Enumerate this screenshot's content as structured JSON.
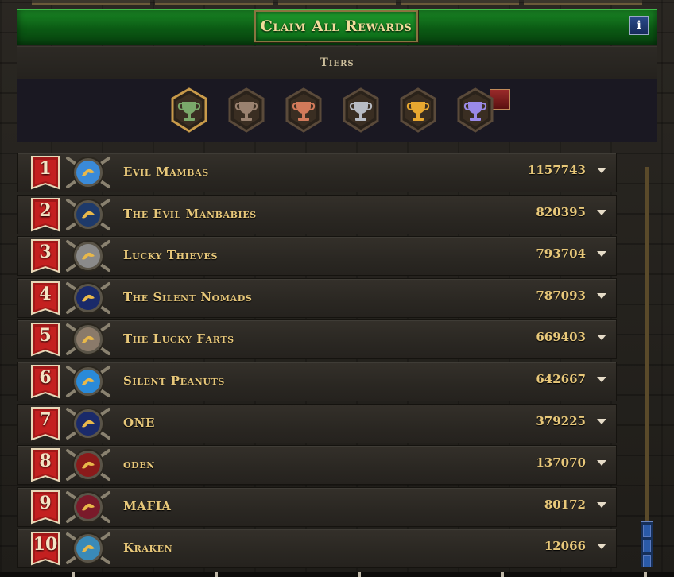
{
  "header": {
    "claim_label": "Claim All Rewards",
    "info_label": "i"
  },
  "tiers": {
    "title": "Tiers",
    "items": [
      {
        "name": "trophy-green-icon",
        "color": "#7aa86a",
        "selected": true
      },
      {
        "name": "trophy-bronze-dark-icon",
        "color": "#9a8270",
        "selected": false
      },
      {
        "name": "trophy-copper-icon",
        "color": "#d27a5a",
        "selected": false
      },
      {
        "name": "trophy-silver-icon",
        "color": "#b8bcc4",
        "selected": false
      },
      {
        "name": "trophy-gold-icon",
        "color": "#e8a830",
        "selected": false
      },
      {
        "name": "trophy-purple-icon",
        "color": "#9a8ae8",
        "selected": false
      }
    ]
  },
  "leaderboard": [
    {
      "rank": "1",
      "name": "Evil Mambas",
      "score": "1157743",
      "emblem": "serpent-emblem-icon",
      "emblem_color": "#3a8ad8"
    },
    {
      "rank": "2",
      "name": "The Evil Manbabies",
      "score": "820395",
      "emblem": "serpent-emblem-icon",
      "emblem_color": "#1e3a6a"
    },
    {
      "rank": "3",
      "name": "Lucky Thieves",
      "score": "793704",
      "emblem": "fleur-emblem-icon",
      "emblem_color": "#8a8a8a"
    },
    {
      "rank": "4",
      "name": "The Silent Nomads",
      "score": "787093",
      "emblem": "bird-emblem-icon",
      "emblem_color": "#1a2a6a"
    },
    {
      "rank": "5",
      "name": "The Lucky Farts",
      "score": "669403",
      "emblem": "ram-emblem-icon",
      "emblem_color": "#8a7a6a"
    },
    {
      "rank": "6",
      "name": "Silent Peanuts",
      "score": "642667",
      "emblem": "eagle-emblem-icon",
      "emblem_color": "#2a8ad8"
    },
    {
      "rank": "7",
      "name": "ONE",
      "score": "379225",
      "emblem": "bird-emblem-icon",
      "emblem_color": "#1a2a6a"
    },
    {
      "rank": "8",
      "name": "oden",
      "score": "137070",
      "emblem": "helmet-emblem-icon",
      "emblem_color": "#8a1a1a"
    },
    {
      "rank": "9",
      "name": "MAFIA",
      "score": "80172",
      "emblem": "axe-emblem-icon",
      "emblem_color": "#7a1a2a"
    },
    {
      "rank": "10",
      "name": "Kraken",
      "score": "12066",
      "emblem": "kraken-emblem-icon",
      "emblem_color": "#3a8ab8"
    }
  ]
}
